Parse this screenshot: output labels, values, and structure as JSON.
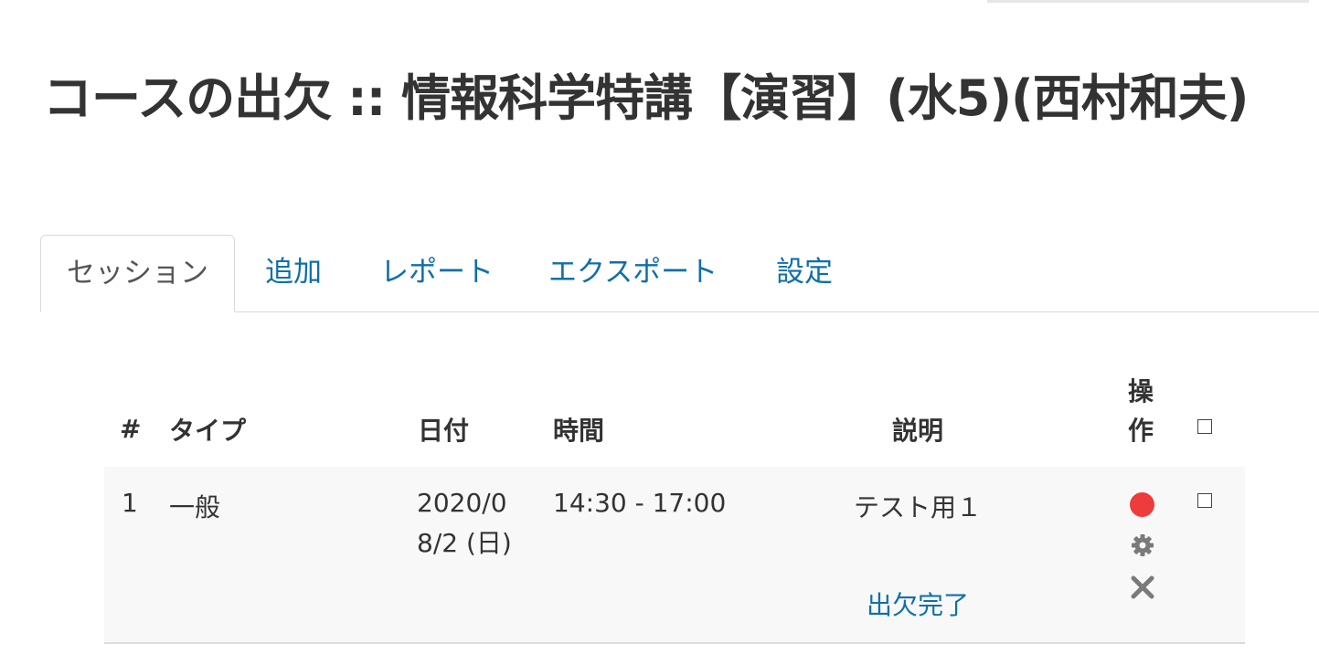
{
  "page": {
    "title": "コースの出欠 :: 情報科学特講【演習】(水5)(西村和夫)"
  },
  "tabs": [
    {
      "label": "セッション",
      "active": true
    },
    {
      "label": "追加",
      "active": false
    },
    {
      "label": "レポート",
      "active": false
    },
    {
      "label": "エクスポート",
      "active": false
    },
    {
      "label": "設定",
      "active": false
    }
  ],
  "table": {
    "headers": {
      "num": "#",
      "type": "タイプ",
      "date": "日付",
      "time": "時間",
      "description": "説明",
      "actions": "操作"
    },
    "rows": [
      {
        "num": "1",
        "type": "一般",
        "date": "2020/08/2 (日)",
        "time": "14:30 - 17:00",
        "description": "テスト用１",
        "status_link": "出欠完了",
        "icons": [
          "record-attendance-icon",
          "gear-icon",
          "delete-icon"
        ]
      }
    ]
  },
  "colors": {
    "link": "#0f6fa8",
    "record": "#ee3b3b",
    "icon_gray": "#7a7a7a",
    "row_bg": "#f8f8f8"
  }
}
